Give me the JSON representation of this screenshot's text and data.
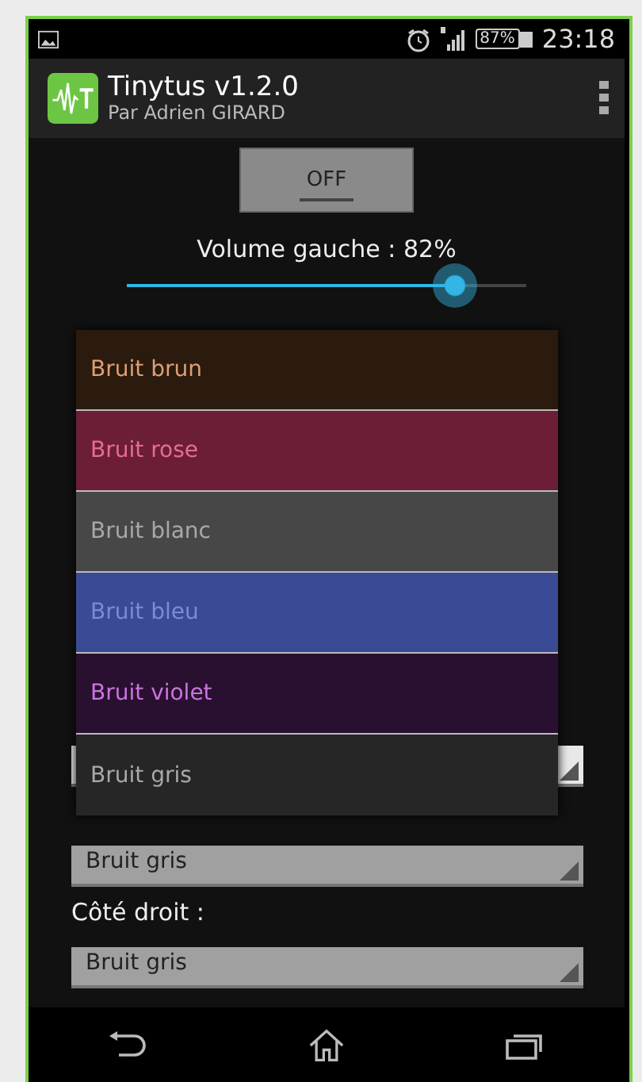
{
  "status_bar": {
    "time": "23:18",
    "battery": "87%"
  },
  "app_bar": {
    "title": "Tinytus v1.2.0",
    "subtitle": "Par Adrien GIRARD"
  },
  "toggle": {
    "label": "OFF",
    "on": false
  },
  "volume": {
    "label": "Volume gauche : 82%",
    "level": 0.82
  },
  "spinners": [
    {
      "value": "Bruit gris"
    }
  ],
  "right_label": "Côté droit :",
  "right_spinner": {
    "value": "Bruit gris"
  },
  "dropdown": [
    {
      "label": "Bruit brun",
      "color": "#2b1a0e"
    },
    {
      "label": "Bruit rose",
      "color": "#6b1e36"
    },
    {
      "label": "Bruit blanc",
      "color": "#474747"
    },
    {
      "label": "Bruit bleu",
      "color": "#3a4a94"
    },
    {
      "label": "Bruit violet",
      "color": "#2a1030"
    },
    {
      "label": "Bruit gris",
      "color": "#262626"
    }
  ]
}
